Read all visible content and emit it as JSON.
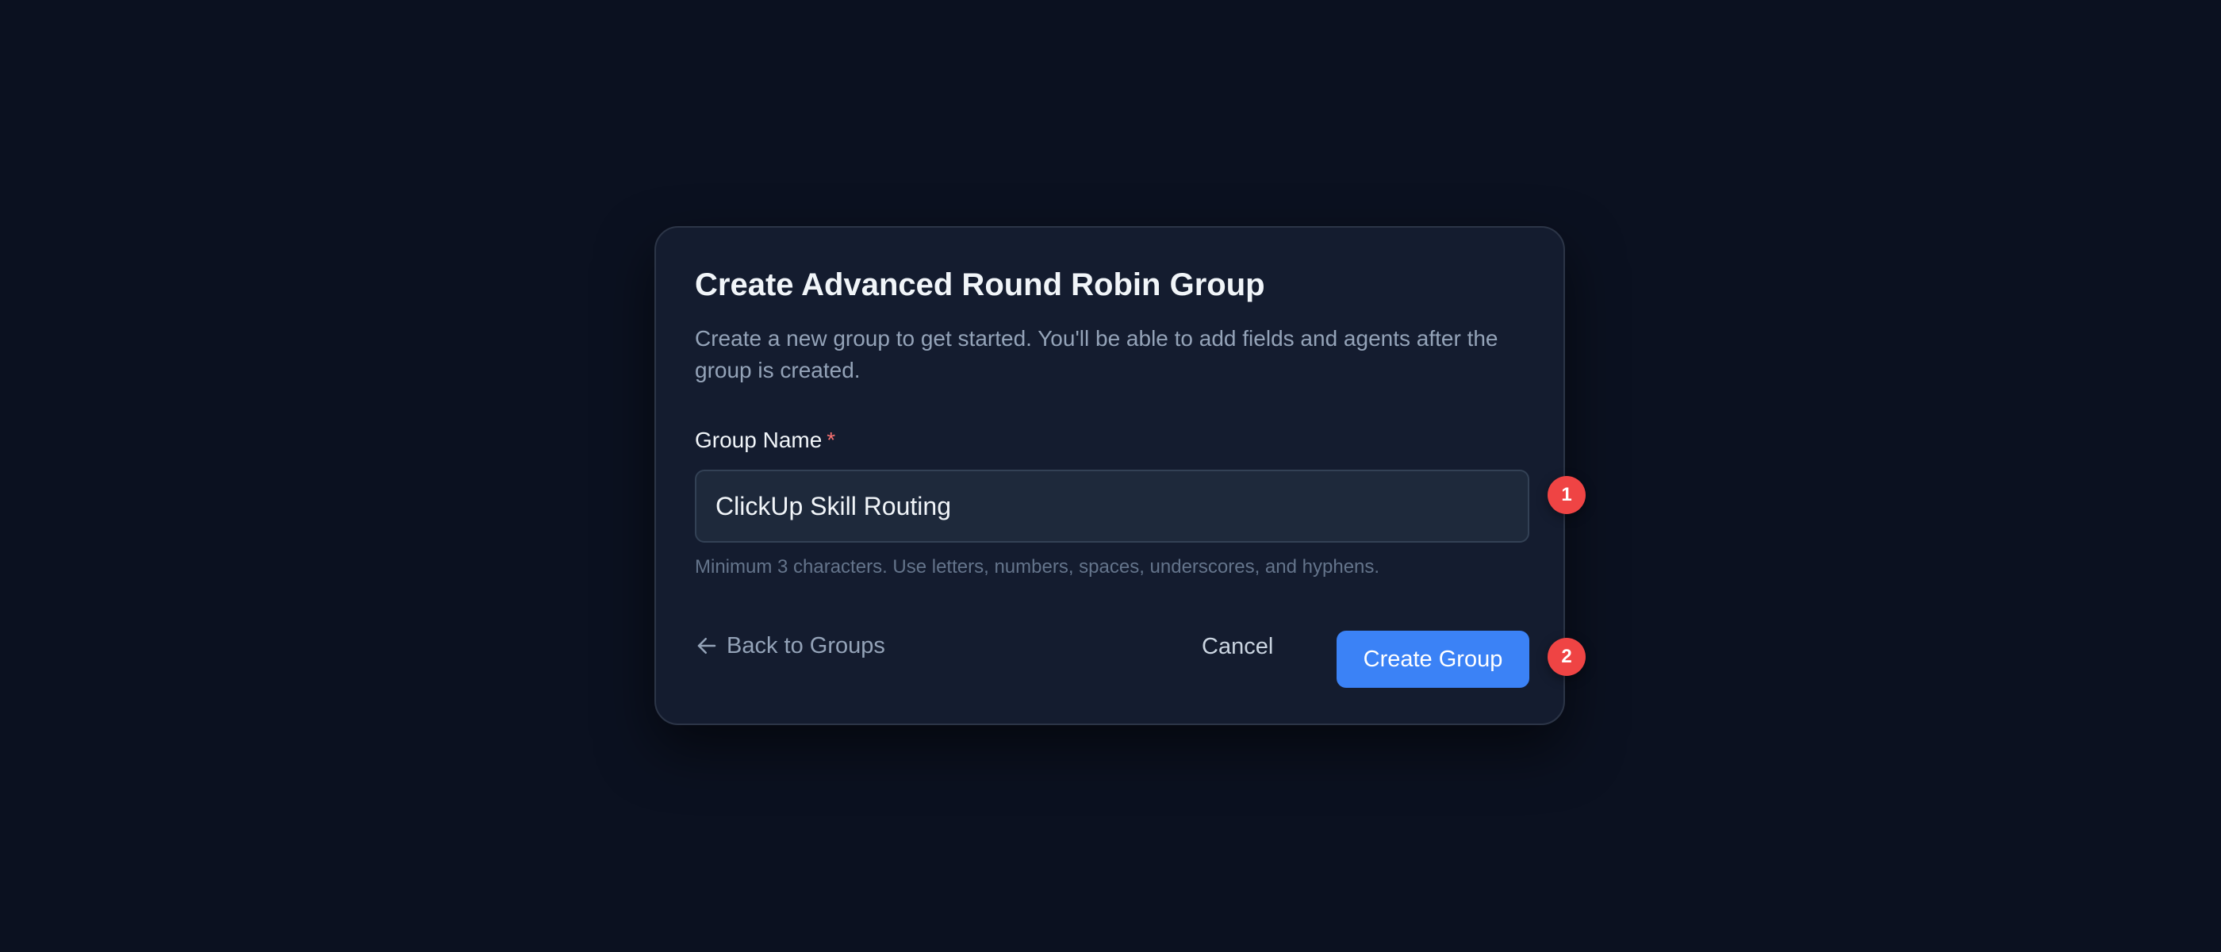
{
  "dialog": {
    "title": "Create Advanced Round Robin Group",
    "description": "Create a new group to get started. You'll be able to add fields and agents after the group is created.",
    "group_name_label": "Group Name",
    "required_marker": "*",
    "group_name_value": "ClickUp Skill Routing",
    "helper_text": "Minimum 3 characters. Use letters, numbers, spaces, underscores, and hyphens.",
    "back_link_label": "Back to Groups",
    "back_icon": "arrow-left-icon",
    "cancel_label": "Cancel",
    "create_label": "Create Group"
  },
  "annotations": {
    "badge_1": "1",
    "badge_2": "2"
  },
  "colors": {
    "background": "#0b1120",
    "card": "#141c2f",
    "primary": "#3b82f6",
    "badge": "#ef4444",
    "required": "#f87171"
  }
}
